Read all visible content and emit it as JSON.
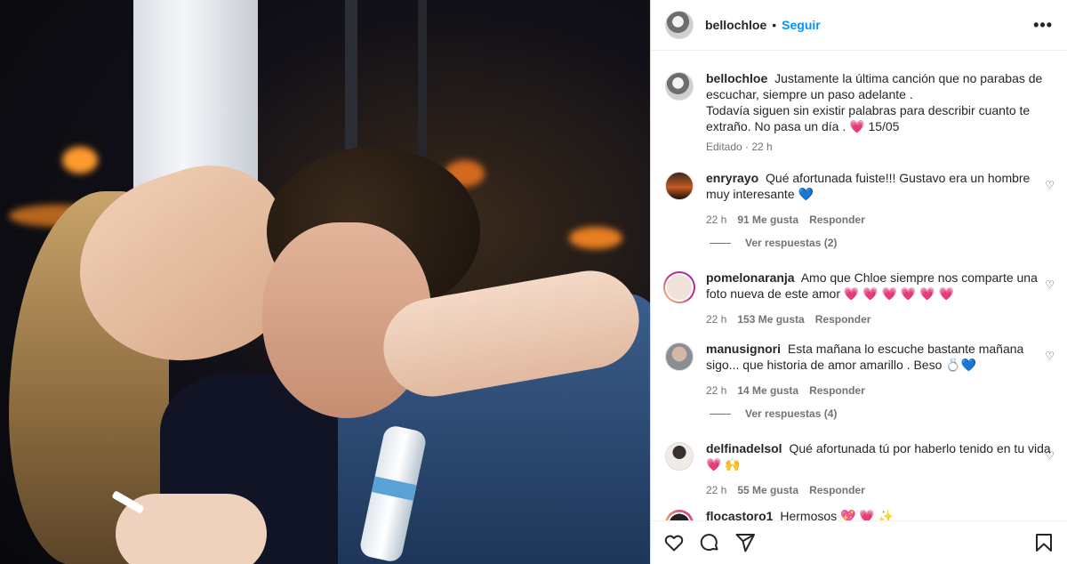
{
  "post": {
    "username": "bellochloe",
    "follow_label": "Seguir",
    "separator": "•",
    "more_icon": "more-icon"
  },
  "caption": {
    "username": "bellochloe",
    "line1": "Justamente la última canción que no parabas de escuchar, siempre un paso adelante .",
    "line2": "Todavía siguen sin existir palabras para describir cuanto te extraño. No pasa un día .",
    "heart": "💗",
    "date_tag": "15/05",
    "edited": "Editado · 22 h"
  },
  "comments": [
    {
      "username": "enryrayo",
      "text": "Qué afortunada fuiste!!! Gustavo era un hombre muy interesante",
      "emoji": "💙",
      "time": "22 h",
      "likes": "91 Me gusta",
      "reply": "Responder",
      "view_replies": "Ver respuestas (2)"
    },
    {
      "username": "pomelonaranja",
      "text": "Amo que Chloe siempre nos comparte una foto nueva de este amor",
      "emoji": "💗 💗 💗 💗 💗 💗",
      "time": "22 h",
      "likes": "153 Me gusta",
      "reply": "Responder"
    },
    {
      "username": "manusignori",
      "text": "Esta mañana lo escuche bastante mañana sigo... que historia de amor amarillo . Beso",
      "emoji": "💍💙",
      "time": "22 h",
      "likes": "14 Me gusta",
      "reply": "Responder",
      "view_replies": "Ver respuestas (4)"
    },
    {
      "username": "delfinadelsol",
      "text": "Qué afortunada tú por haberlo tenido en tu vida",
      "emoji": "💗 🙌",
      "time": "22 h",
      "likes": "55 Me gusta",
      "reply": "Responder"
    },
    {
      "username": "flocastoro1",
      "text": "Hermosos",
      "emoji": "💖 💗 ✨"
    }
  ],
  "colors": {
    "link_blue": "#0095f6",
    "muted": "#737373",
    "text": "#262626"
  }
}
